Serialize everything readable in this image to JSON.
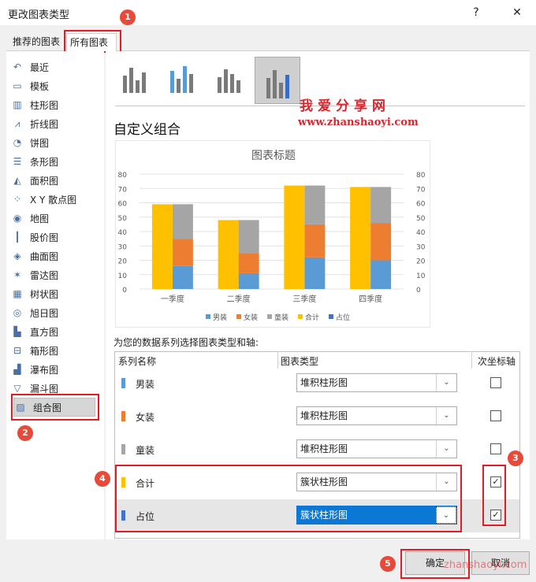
{
  "window": {
    "title": "更改图表类型",
    "help": "?",
    "close": "✕"
  },
  "tabs": [
    {
      "label": "推荐的图表"
    },
    {
      "label": "所有图表"
    }
  ],
  "badges": [
    "1",
    "2",
    "3",
    "4",
    "5"
  ],
  "sidebar": {
    "items": [
      {
        "label": "最近",
        "icon": "recent-icon",
        "glyph": "↶"
      },
      {
        "label": "模板",
        "icon": "template-icon",
        "glyph": "▭"
      },
      {
        "label": "柱形图",
        "icon": "column-chart-icon",
        "glyph": "▥"
      },
      {
        "label": "折线图",
        "icon": "line-chart-icon",
        "glyph": "⩘"
      },
      {
        "label": "饼图",
        "icon": "pie-chart-icon",
        "glyph": "◔"
      },
      {
        "label": "条形图",
        "icon": "bar-chart-icon",
        "glyph": "☰"
      },
      {
        "label": "面积图",
        "icon": "area-chart-icon",
        "glyph": "◭"
      },
      {
        "label": "X Y 散点图",
        "icon": "scatter-chart-icon",
        "glyph": "⁘"
      },
      {
        "label": "地图",
        "icon": "map-chart-icon",
        "glyph": "◉"
      },
      {
        "label": "股价图",
        "icon": "stock-chart-icon",
        "glyph": "┃"
      },
      {
        "label": "曲面图",
        "icon": "surface-chart-icon",
        "glyph": "◈"
      },
      {
        "label": "雷达图",
        "icon": "radar-chart-icon",
        "glyph": "✶"
      },
      {
        "label": "树状图",
        "icon": "treemap-chart-icon",
        "glyph": "▦"
      },
      {
        "label": "旭日图",
        "icon": "sunburst-chart-icon",
        "glyph": "◎"
      },
      {
        "label": "直方图",
        "icon": "histogram-chart-icon",
        "glyph": "▙"
      },
      {
        "label": "箱形图",
        "icon": "boxplot-chart-icon",
        "glyph": "⊟"
      },
      {
        "label": "瀑布图",
        "icon": "waterfall-chart-icon",
        "glyph": "▟"
      },
      {
        "label": "漏斗图",
        "icon": "funnel-chart-icon",
        "glyph": "▽"
      },
      {
        "label": "组合图",
        "icon": "combo-chart-icon",
        "glyph": "▨"
      }
    ]
  },
  "combo": {
    "heading": "自定义组合"
  },
  "watermark": {
    "line1": "我爱分享网",
    "line2": "www.zhanshaoyi.com",
    "line3": "zhanshaoyi.com"
  },
  "chart_data": {
    "type": "bar",
    "title": "图表标题",
    "categories": [
      "一季度",
      "二季度",
      "三季度",
      "四季度"
    ],
    "ylim": [
      0,
      80
    ],
    "y_ticks": [
      "0",
      "10",
      "20",
      "30",
      "40",
      "50",
      "60",
      "70",
      "80"
    ],
    "legend_position": "bottom",
    "series": [
      {
        "name": "男装",
        "values": [
          16,
          11,
          22,
          20
        ],
        "color": "#5b9bd5",
        "stack": "A"
      },
      {
        "name": "女装",
        "values": [
          19,
          14,
          23,
          26
        ],
        "color": "#ed7d31",
        "stack": "A"
      },
      {
        "name": "童装",
        "values": [
          24,
          23,
          27,
          25
        ],
        "color": "#a5a5a5",
        "stack": "A"
      },
      {
        "name": "合计",
        "values": [
          59,
          48,
          72,
          71
        ],
        "color": "#ffc000",
        "stack": "B"
      },
      {
        "name": "占位",
        "values": [
          0,
          0,
          0,
          0
        ],
        "color": "#4472c4",
        "stack": "C"
      }
    ]
  },
  "series_section": {
    "label": "为您的数据系列选择图表类型和轴:",
    "col_name": "系列名称",
    "col_type": "图表类型",
    "col_axis": "次坐标轴",
    "rows": [
      {
        "name": "男装",
        "type": "堆积柱形图",
        "secondary": "",
        "color": "#5b9bd5"
      },
      {
        "name": "女装",
        "type": "堆积柱形图",
        "secondary": "",
        "color": "#ed7d31"
      },
      {
        "name": "童装",
        "type": "堆积柱形图",
        "secondary": "",
        "color": "#a5a5a5"
      },
      {
        "name": "合计",
        "type": "簇状柱形图",
        "secondary": "✓",
        "color": "#ffc000"
      },
      {
        "name": "占位",
        "type": "簇状柱形图",
        "secondary": "✓",
        "color": "#4472c4"
      }
    ]
  },
  "buttons": {
    "ok": "确定",
    "cancel": "取消"
  }
}
